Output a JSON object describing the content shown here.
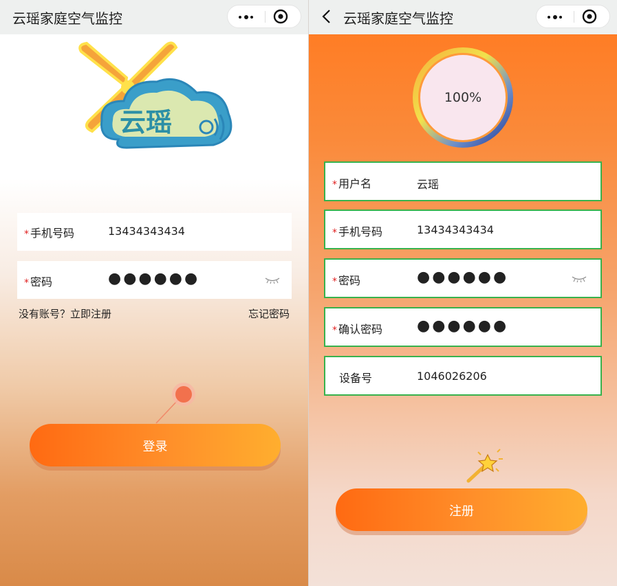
{
  "app": {
    "title": "云瑶家庭空气监控"
  },
  "login": {
    "logo_text": "云瑶",
    "phone": {
      "label": "手机号码",
      "value": "13434343434"
    },
    "password": {
      "label": "密码",
      "value": "●●●●●●"
    },
    "register_link": "没有账号？立即注册",
    "forgot_link": "忘记密码",
    "submit_label": "登录"
  },
  "register": {
    "progress_text": "100%",
    "progress_value": 1.0,
    "username": {
      "label": "用户名",
      "value": "云瑶"
    },
    "phone": {
      "label": "手机号码",
      "value": "13434343434"
    },
    "password": {
      "label": "密码",
      "value": "●●●●●●"
    },
    "confirm_password": {
      "label": "确认密码",
      "value": "●●●●●●"
    },
    "device": {
      "label": "设备号",
      "value": "1046026206"
    },
    "submit_label": "注册"
  },
  "required_marker": "*",
  "colors": {
    "accent_orange": "#ff7d25",
    "field_border_green": "#37b24d",
    "required_red": "#e02020",
    "titlebar_bg": "#eef0ef"
  },
  "icons": {
    "capsule_more": "more-dots-icon",
    "capsule_close": "target-close-icon",
    "back": "chevron-left-icon",
    "eye": "eye-closed-icon",
    "pin": "location-pin-icon",
    "wand": "magic-wand-icon"
  }
}
